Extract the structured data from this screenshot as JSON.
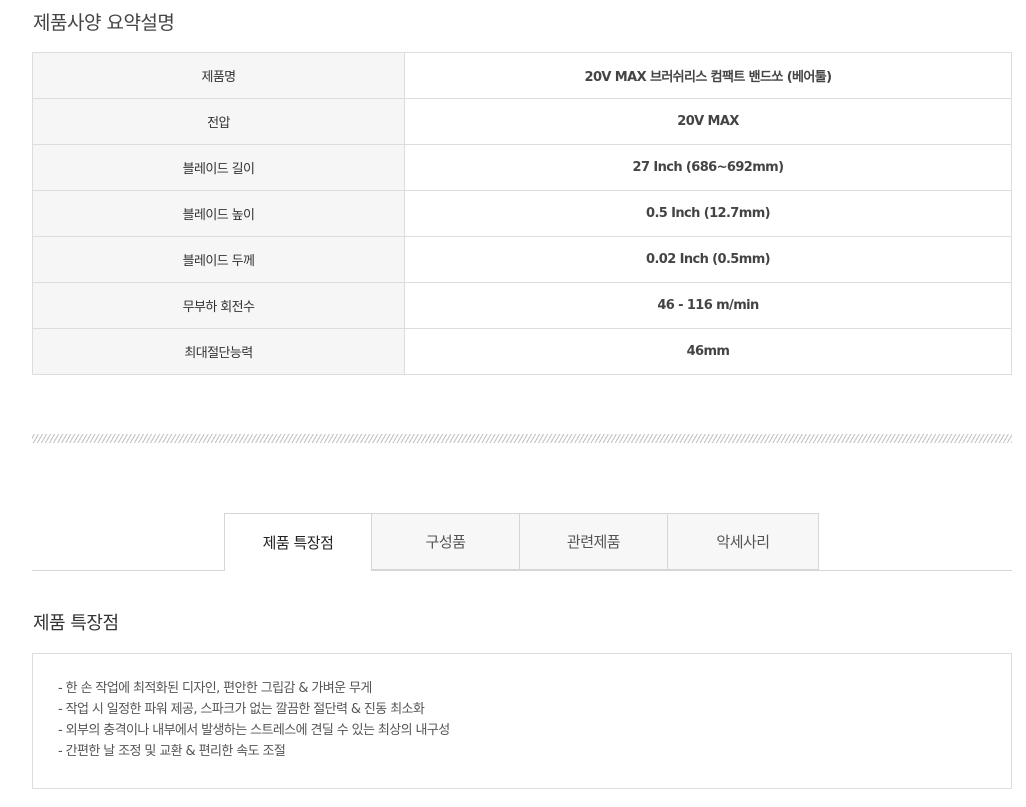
{
  "spec_section": {
    "title": "제품사양 요약설명",
    "rows": [
      {
        "label": "제품명",
        "value": "20V MAX 브러쉬리스 컴팩트 밴드쏘 (베어툴)"
      },
      {
        "label": "전압",
        "value": "20V MAX"
      },
      {
        "label": "블레이드 길이",
        "value": "27 Inch (686~692mm)"
      },
      {
        "label": "블레이드 높이",
        "value": "0.5 Inch (12.7mm)"
      },
      {
        "label": "블레이드 두께",
        "value": "0.02 Inch (0.5mm)"
      },
      {
        "label": "무부하 회전수",
        "value": "46 - 116 m/min"
      },
      {
        "label": "최대절단능력",
        "value": "46mm"
      }
    ]
  },
  "tabs": [
    {
      "label": "제품 특장점",
      "active": true
    },
    {
      "label": "구성품",
      "active": false
    },
    {
      "label": "관련제품",
      "active": false
    },
    {
      "label": "악세사리",
      "active": false
    }
  ],
  "features_section": {
    "title": "제품 특장점",
    "items": [
      "- 한 손 작업에 최적화된 디자인, 편안한 그립감 & 가벼운 무게",
      "- 작업 시 일정한 파워 제공, 스파크가 없는 깔끔한 절단력 & 진동 최소화",
      "- 외부의 충격이나 내부에서 발생하는 스트레스에 견딜 수 있는 최상의 내구성",
      "- 간편한 날 조정 및 교환 & 편리한 속도 조절"
    ]
  },
  "colors": {
    "label_background": "#f6f6f6",
    "border": "#dddddd",
    "tab_inactive_background": "#f7f7f7"
  }
}
